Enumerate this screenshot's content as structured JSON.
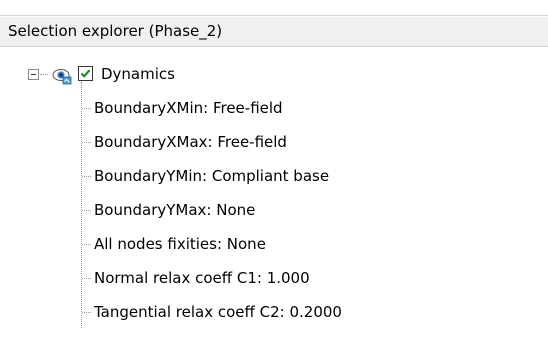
{
  "panel": {
    "title": "Selection explorer (Phase_2)"
  },
  "tree": {
    "root": {
      "label": "Dynamics",
      "checked": true,
      "expanded": true,
      "icon": "eye-icon"
    },
    "children": [
      {
        "label": "BoundaryXMin: Free-field"
      },
      {
        "label": "BoundaryXMax: Free-field"
      },
      {
        "label": "BoundaryYMin: Compliant base"
      },
      {
        "label": "BoundaryYMax: None"
      },
      {
        "label": "All nodes fixities: None"
      },
      {
        "label": "Normal relax coeff C1: 1.000"
      },
      {
        "label": "Tangential relax coeff C2: 0.2000"
      }
    ]
  },
  "colors": {
    "check": "#1a7f1a",
    "eye": "#3a7bc8"
  }
}
